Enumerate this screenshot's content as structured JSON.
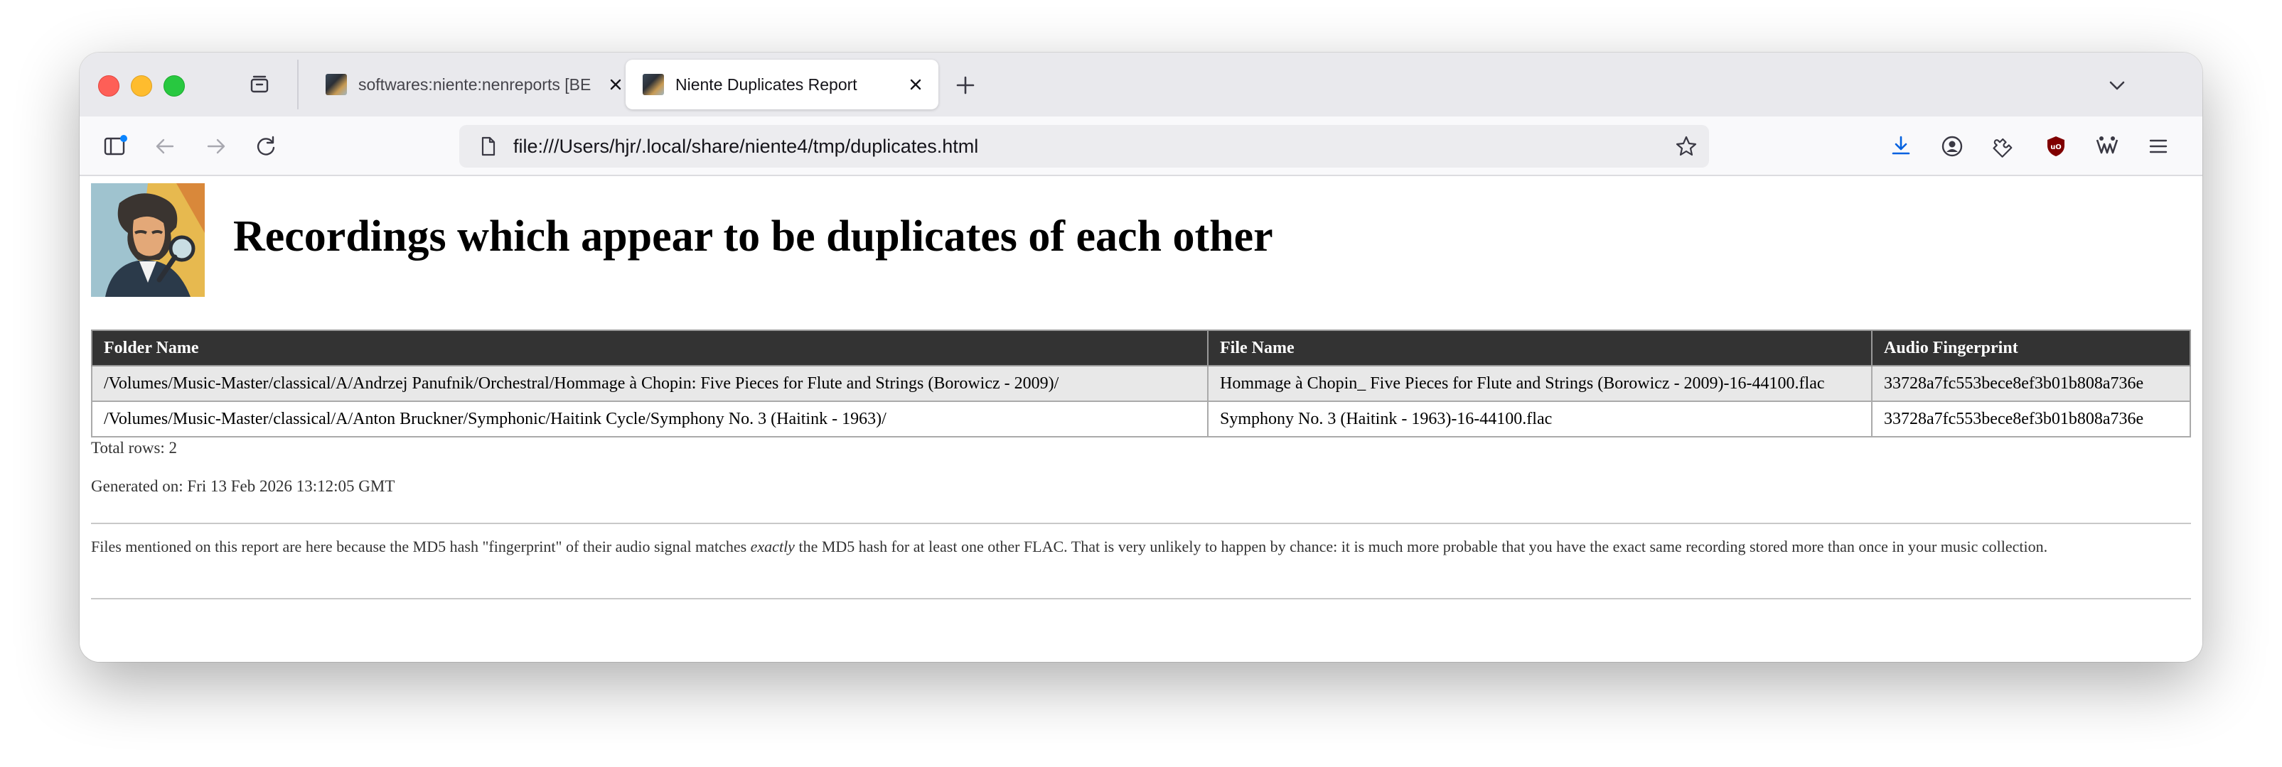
{
  "browser": {
    "tabs": [
      {
        "title": "softwares:niente:nenreports [BE",
        "active": false
      },
      {
        "title": "Niente Duplicates Report",
        "active": true
      }
    ],
    "url": "file:///Users/hjr/.local/share/niente4/tmp/duplicates.html"
  },
  "page": {
    "title": "Recordings which appear to be duplicates of each other",
    "table": {
      "headers": [
        "Folder Name",
        "File Name",
        "Audio Fingerprint"
      ],
      "rows": [
        {
          "folder": "/Volumes/Music-Master/classical/A/Andrzej Panufnik/Orchestral/Hommage à Chopin: Five Pieces for Flute and Strings (Borowicz - 2009)/",
          "file": "Hommage à Chopin_ Five Pieces for Flute and Strings (Borowicz - 2009)-16-44100.flac",
          "fingerprint": "33728a7fc553bece8ef3b01b808a736e"
        },
        {
          "folder": "/Volumes/Music-Master/classical/A/Anton Bruckner/Symphonic/Haitink Cycle/Symphony No. 3 (Haitink - 1963)/",
          "file": "Symphony No. 3 (Haitink - 1963)-16-44100.flac",
          "fingerprint": "33728a7fc553bece8ef3b01b808a736e"
        }
      ]
    },
    "total_rows": "Total rows: 2",
    "generated": "Generated on: Fri 13 Feb 2026 13:12:05 GMT",
    "note": {
      "before": "Files mentioned on this report are here because the MD5 hash \"fingerprint\" of their audio signal matches ",
      "emphasis": "exactly",
      "after": " the MD5 hash for at least one other FLAC. That is very unlikely to happen by chance: it is much more probable that you have the exact same recording stored more than once in your music collection."
    }
  },
  "colors": {
    "header_bg": "#333333",
    "row_odd_bg": "#e8e8e8",
    "download_accent": "#0061e0",
    "ublock_red": "#800000"
  }
}
